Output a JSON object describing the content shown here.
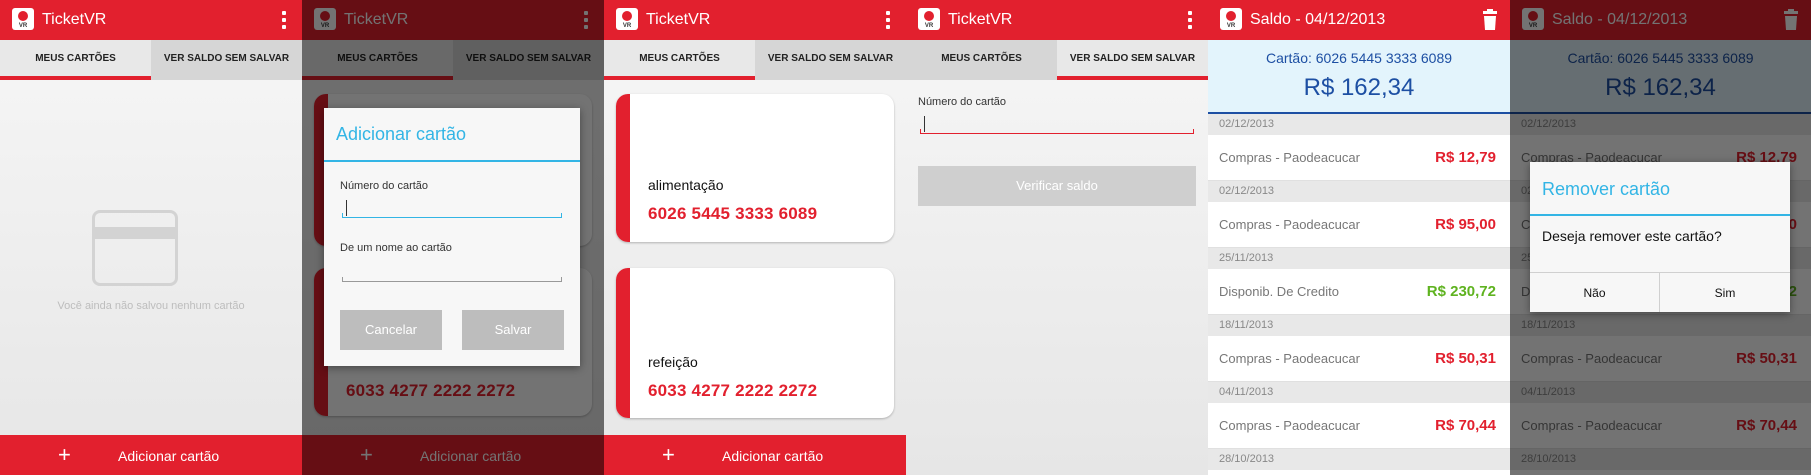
{
  "app": {
    "name": "TicketVR",
    "logo_text": "VR",
    "accent": "#e2202e",
    "dialog_accent": "#33b5e5"
  },
  "tabs": {
    "my_cards": "MEUS CARTÕES",
    "check_balance": "VER SALDO SEM SALVAR"
  },
  "bottom": {
    "add_card": "Adicionar cartão"
  },
  "empty": {
    "message": "Você ainda não salvou nenhum cartão"
  },
  "add_dialog": {
    "title": "Adicionar cartão",
    "card_number_label": "Número do cartão",
    "card_name_label": "De um nome ao cartão",
    "cancel": "Cancelar",
    "save": "Salvar"
  },
  "cards": [
    {
      "type": "alimentação",
      "number": "6026 5445 3333 6089"
    },
    {
      "type": "refeição",
      "number": "6033 4277 2222 2272"
    }
  ],
  "check": {
    "card_number_label": "Número do cartão",
    "verify_button": "Verificar saldo"
  },
  "balance": {
    "title": "Saldo - 04/12/2013",
    "card_line": "Cartão: 6026 5445 3333 6089",
    "amount": "R$ 162,34",
    "transactions": [
      {
        "date": "02/12/2013",
        "desc": "Compras - Paodeacucar",
        "value": "R$ 12,79",
        "kind": "neg"
      },
      {
        "date": "02/12/2013",
        "desc": "Compras - Paodeacucar",
        "value": "R$ 95,00",
        "kind": "neg"
      },
      {
        "date": "25/11/2013",
        "desc": "Disponib. De Credito",
        "value": "R$ 230,72",
        "kind": "pos"
      },
      {
        "date": "18/11/2013",
        "desc": "Compras - Paodeacucar",
        "value": "R$ 50,31",
        "kind": "neg"
      },
      {
        "date": "04/11/2013",
        "desc": "Compras - Paodeacucar",
        "value": "R$ 70,44",
        "kind": "neg"
      },
      {
        "date": "28/10/2013",
        "desc": "",
        "value": "",
        "kind": "neg"
      }
    ]
  },
  "remove_dialog": {
    "title": "Remover cartão",
    "question": "Deseja remover este cartão?",
    "no": "Não",
    "yes": "Sim"
  },
  "icons": {
    "overflow": "overflow-menu-icon",
    "trash": "trash-icon",
    "plus": "plus-icon",
    "card": "credit-card-icon"
  }
}
